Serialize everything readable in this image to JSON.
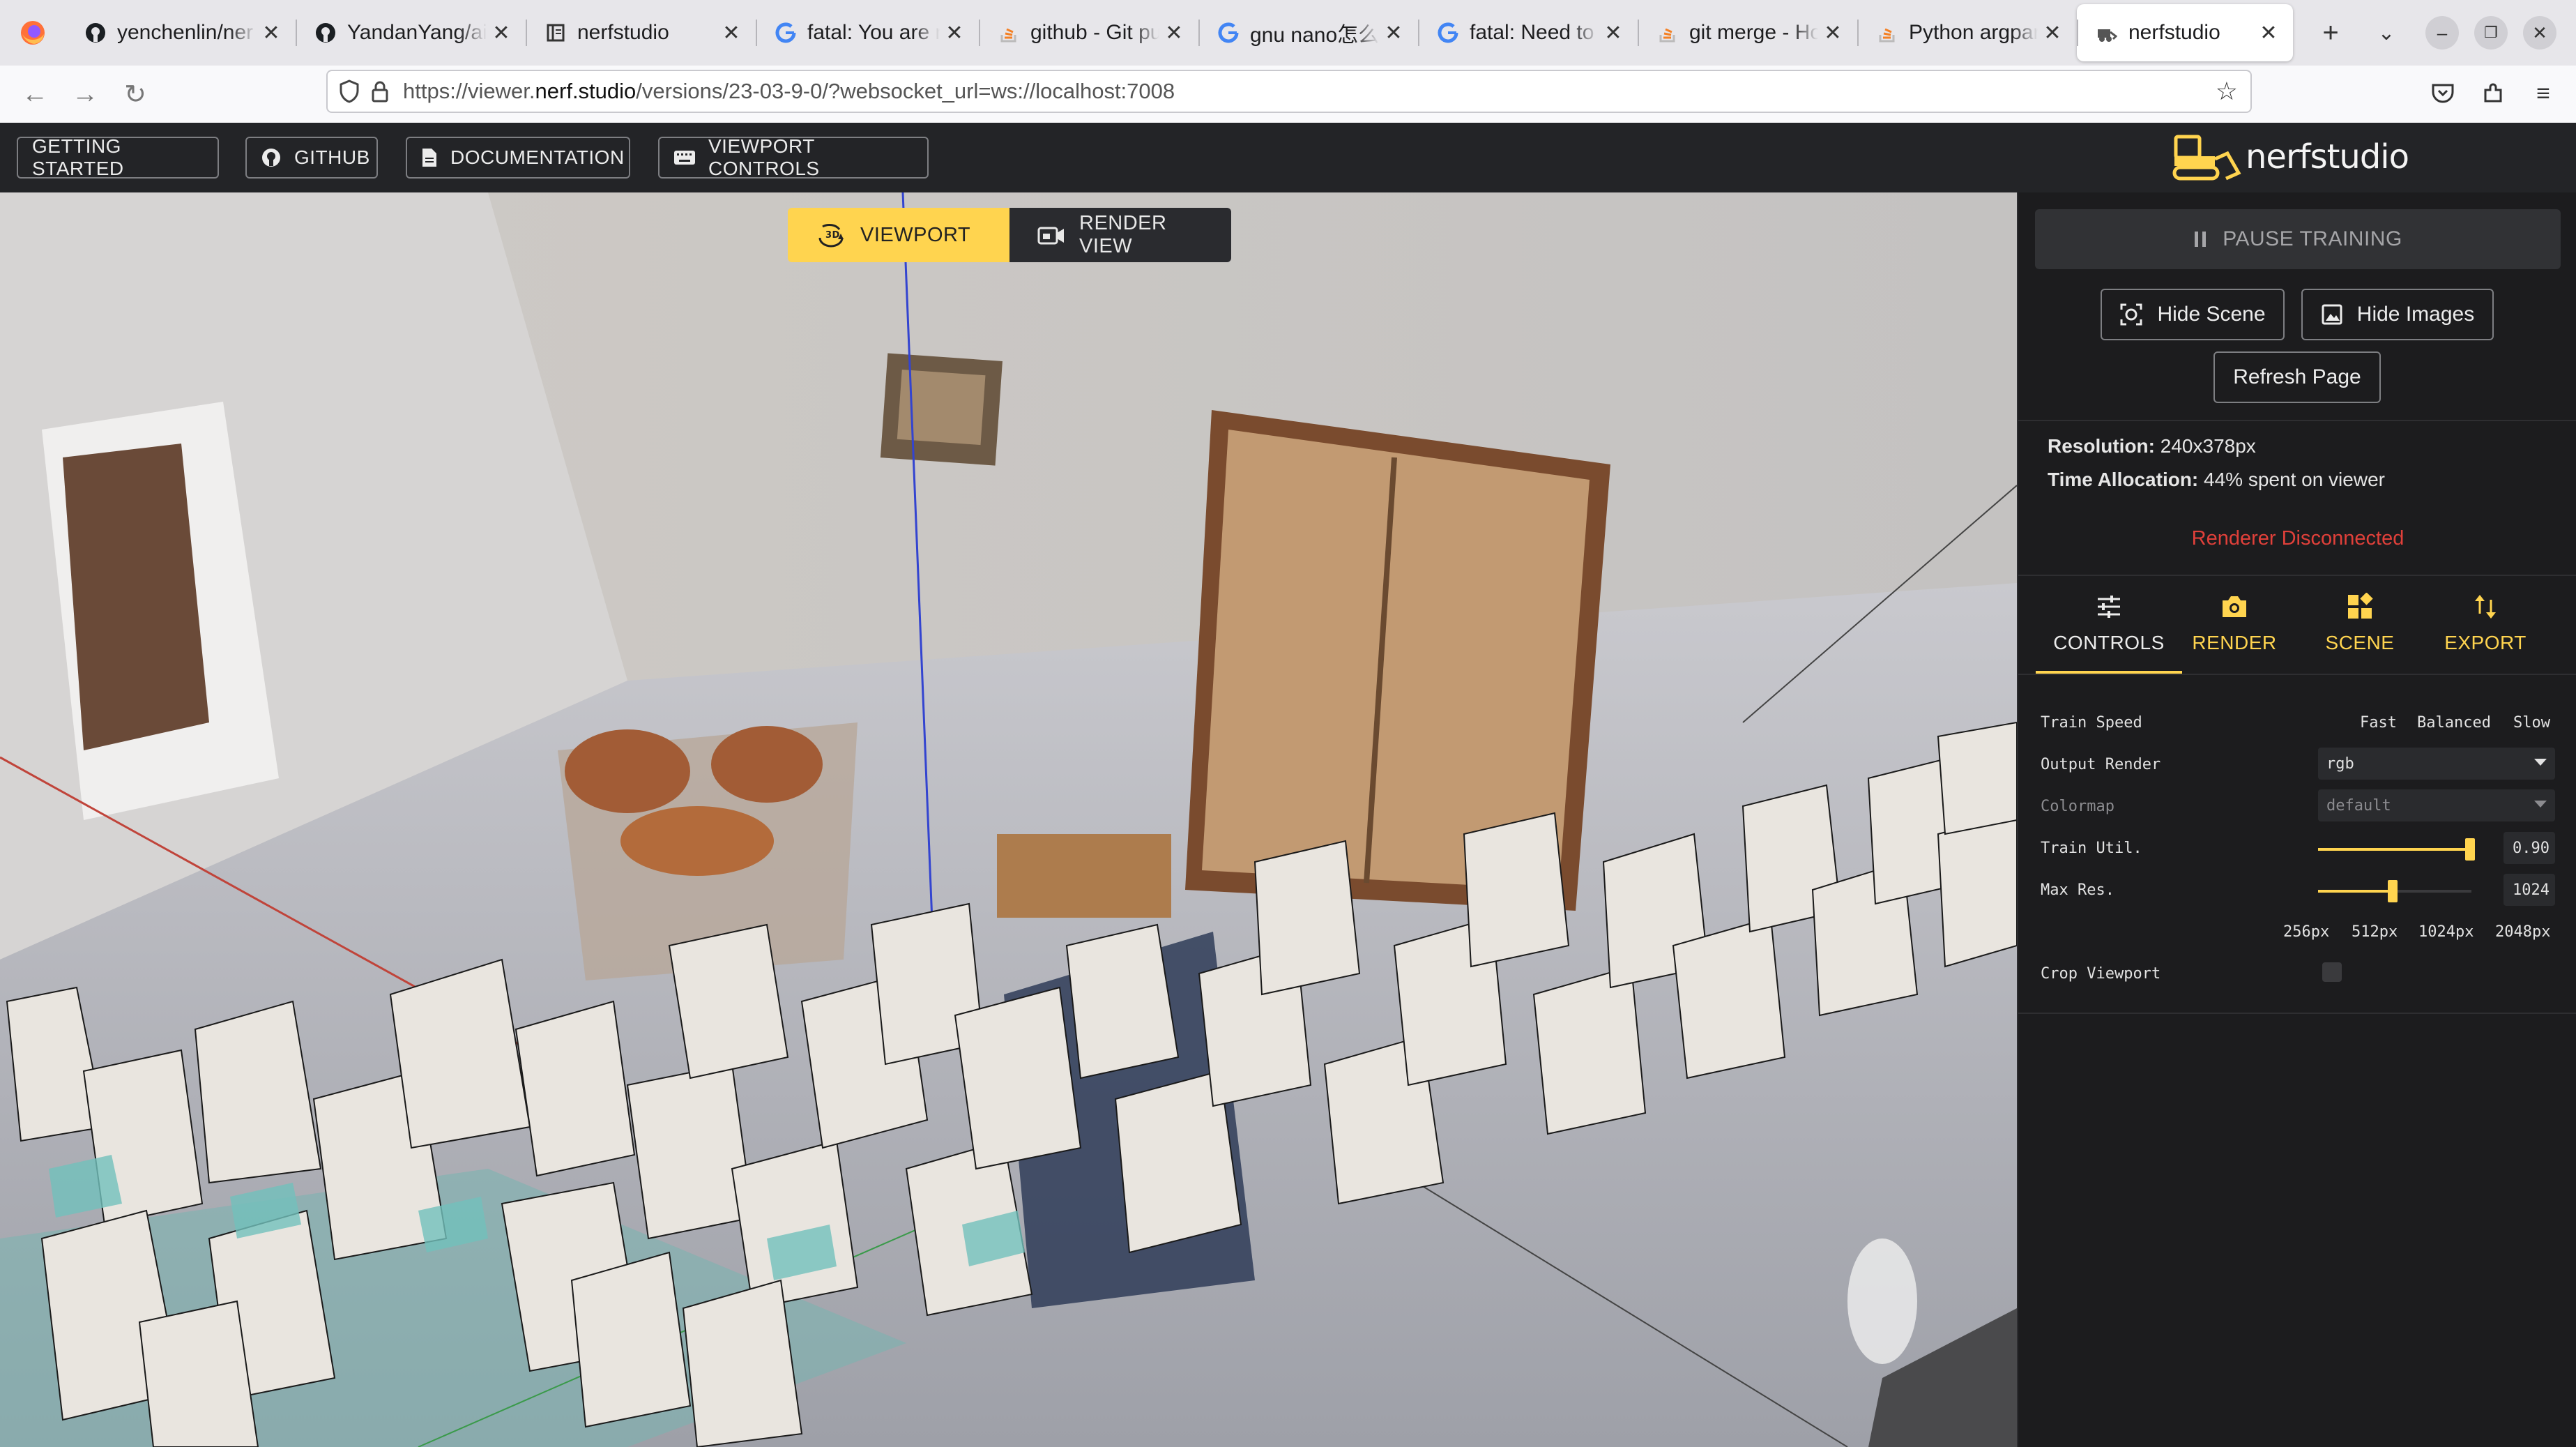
{
  "browser": {
    "tabs": [
      {
        "title": "yenchenlin/ner",
        "favicon": "github-icon"
      },
      {
        "title": "YandanYang/ai",
        "favicon": "github-icon"
      },
      {
        "title": "nerfstudio",
        "favicon": "document-icon"
      },
      {
        "title": "fatal: You are n",
        "favicon": "google-icon"
      },
      {
        "title": "github - Git pus",
        "favicon": "stackoverflow-icon"
      },
      {
        "title": "gnu nano怎么保",
        "favicon": "google-icon"
      },
      {
        "title": "fatal: Need to s",
        "favicon": "google-icon"
      },
      {
        "title": "git merge - How",
        "favicon": "stackoverflow-icon"
      },
      {
        "title": "Python argpars",
        "favicon": "stackoverflow-icon"
      },
      {
        "title": "nerfstudio",
        "favicon": "nerfstudio-icon",
        "active": true
      }
    ],
    "url": {
      "prefix": "https://viewer.",
      "domain": "nerf.studio",
      "path": "/versions/23-03-9-0/?websocket_url=ws://localhost:7008"
    }
  },
  "header": {
    "buttons": {
      "getting_started": "GETTING STARTED",
      "github": "GITHUB",
      "documentation": "DOCUMENTATION",
      "viewport_controls": "VIEWPORT CONTROLS"
    },
    "brand": "nerfstudio"
  },
  "viewport": {
    "toggle": {
      "viewport": "VIEWPORT",
      "render_view": "RENDER VIEW",
      "selected": "viewport"
    }
  },
  "panel": {
    "pause_training": "PAUSE TRAINING",
    "hide_scene": "Hide Scene",
    "hide_images": "Hide Images",
    "refresh_page": "Refresh Page",
    "resolution_label": "Resolution:",
    "resolution_value": "240x378px",
    "time_label": "Time Allocation:",
    "time_value": "44% spent on viewer",
    "renderer_status": "Renderer Disconnected",
    "tabs": [
      {
        "label": "CONTROLS",
        "icon": "sliders-icon",
        "active": true
      },
      {
        "label": "RENDER",
        "icon": "camera-icon"
      },
      {
        "label": "SCENE",
        "icon": "widgets-icon"
      },
      {
        "label": "EXPORT",
        "icon": "import-export-icon"
      }
    ],
    "controls": {
      "train_speed": {
        "label": "Train Speed",
        "options": [
          "Fast",
          "Balanced",
          "Slow"
        ]
      },
      "output_render": {
        "label": "Output Render",
        "value": "rgb"
      },
      "colormap": {
        "label": "Colormap",
        "value": "default"
      },
      "train_util": {
        "label": "Train Util.",
        "value": "0.90",
        "fraction": 0.9
      },
      "max_res": {
        "label": "Max Res.",
        "value": "1024",
        "ticks": [
          "256px",
          "512px",
          "1024px",
          "2048px"
        ]
      },
      "crop_viewport": {
        "label": "Crop Viewport",
        "checked": false
      }
    }
  },
  "colors": {
    "accent": "#ffd44f",
    "error": "#e0403a",
    "panel_bg": "#1c1c1e",
    "header_bg": "#232427"
  }
}
